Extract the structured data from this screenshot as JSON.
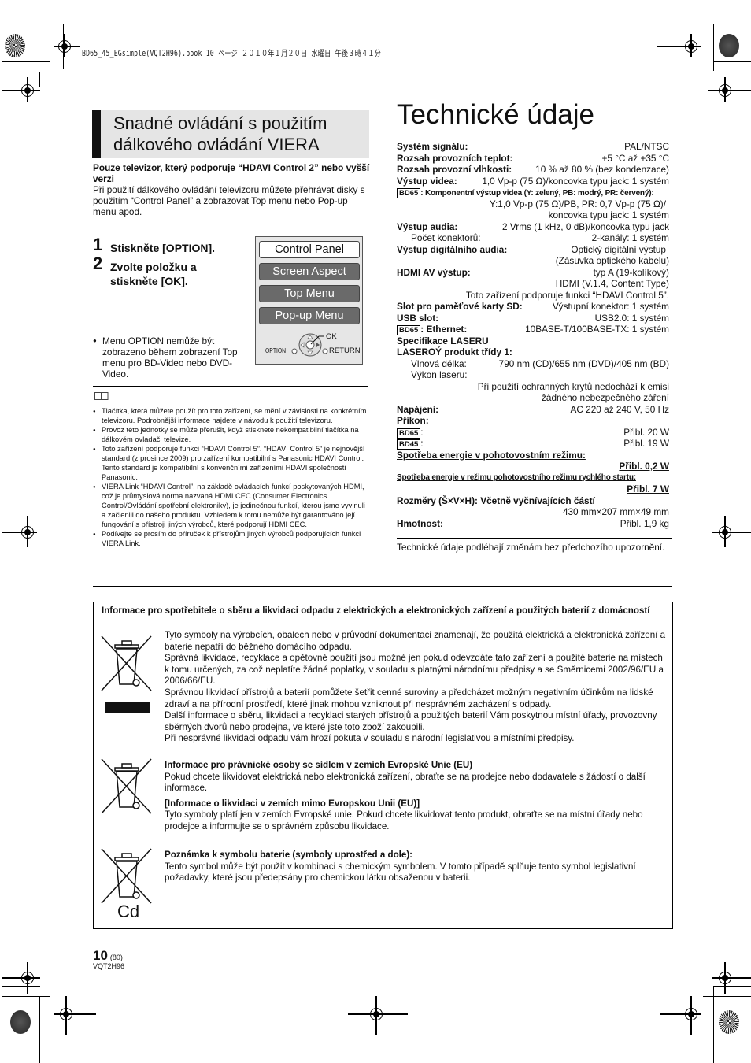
{
  "print_header": "BD65_45_EGsimple(VQT2H96).book  10 ページ  ２０１０年１月２０日  水曜日  午後３時４１分",
  "left": {
    "section_title_line1": "Snadné ovládání s použitím",
    "section_title_line2": "dálkového ovládání VIERA",
    "intro_bold": "Pouze televizor, který podporuje “HDAVI Control 2” nebo vyšší verzi",
    "intro_text": "Při použití dálkového ovládání televizoru můžete přehrávat disky s použitím “Control Panel” a zobrazovat Top menu nebo Pop-up menu apod.",
    "steps": [
      {
        "num": "1",
        "label": "Stiskněte [OPTION]."
      },
      {
        "num": "2",
        "label": "Zvolte položku a stiskněte [OK]."
      }
    ],
    "option_note": "Menu OPTION nemůže být zobrazeno během zobrazení Top menu pro BD-Video nebo DVD-Video.",
    "menu": {
      "items": [
        "Control Panel",
        "Screen Aspect",
        "Top Menu",
        "Pop-up Menu"
      ],
      "selected_index": 0,
      "ok_label": "OK",
      "option_label": "OPTION",
      "return_label": "RETURN"
    },
    "notes": [
      "Tlačítka, která můžete použít pro toto zařízení, se mění v závislosti na konkrétním televizoru. Podrobnější informace najdete v návodu k použití televizoru.",
      "Provoz této jednotky se může přerušit, když stisknete nekompatibilní tlačítka na dálkovém ovladači televize.",
      "Toto zařízení podporuje funkci “HDAVI Control 5”. “HDAVI Control 5” je nejnovější standard (z prosince 2009) pro zařízení kompatibilní s Panasonic HDAVI Control. Tento standard je kompatibilní s konvenčními zařízeními HDAVI společnosti Panasonic.",
      "VIERA Link “HDAVI Control”, na základě ovládacích funkcí poskytovaných HDMI, což je průmyslová norma nazvaná HDMI CEC (Consumer Electronics Control/Ovládání spotřební elektroniky), je jedinečnou funkcí, kterou jsme vyvinuli a začlenili do našeho produktu. Vzhledem k tomu nemůže být garantováno její fungování s přístroji jiných výrobců, které podporují HDMI CEC.",
      "Podívejte se prosím do příruček k přístrojům jiných výrobců podporujících funkci VIERA Link."
    ]
  },
  "right": {
    "title": "Technické údaje",
    "specs": {
      "signal_label": "Systém signálu:",
      "signal_value": "PAL/NTSC",
      "temp_label": "Rozsah provozních teplot:",
      "temp_value": "+5 °C až +35 °C",
      "humidity_label": "Rozsah provozní vlhkosti:",
      "humidity_value": "10 % až 80 % (bez kondenzace)",
      "video_label": "Výstup videa:",
      "video_value": "1,0 Vp-p (75 Ω)/koncovka typu jack: 1 systém",
      "bd65_badge": "BD65",
      "bd45_badge": "BD45",
      "component_label": ": Komponentní výstup videa (Y: zelený, PB: modrý, PR: červený):",
      "component_value1": "Y:1,0 Vp-p (75 Ω)/PB, PR: 0,7 Vp-p (75 Ω)/",
      "component_value2": "koncovka typu jack: 1 systém",
      "audio_label": "Výstup audia:",
      "audio_value": "2 Vrms (1 kHz, 0 dB)/koncovka typu jack",
      "connectors_label": "Počet konektorů:",
      "connectors_value": "2-kanály: 1 systém",
      "digital_audio_label": "Výstup digitálního audia:",
      "digital_audio_value1": "Optický digitální výstup",
      "digital_audio_value2": "(Zásuvka optického kabelu)",
      "hdmi_label": "HDMI AV výstup:",
      "hdmi_value1": "typ A (19-kolíkový)",
      "hdmi_value2": "HDMI (V.1.4, Content Type)",
      "hdmi_value3": "Toto zařízení podporuje funkci “HDAVI Control 5”.",
      "sd_label": "Slot pro paměťové karty SD:",
      "sd_value": "Výstupní konektor: 1 systém",
      "usb_label": "USB slot:",
      "usb_value": "USB2.0: 1 systém",
      "ethernet_label": ": Ethernet:",
      "ethernet_value": "10BASE-T/100BASE-TX: 1 systém",
      "laser_spec": "Specifikace LASERU",
      "laser_class": "LASEROÝ produkt třídy 1:",
      "wavelength_label": "Vlnová délka:",
      "wavelength_value": "790 nm (CD)/655 nm (DVD)/405 nm (BD)",
      "laser_power_label": "Výkon laseru:",
      "laser_power_value1": "Při použití ochranných krytů nedochází k emisi",
      "laser_power_value2": "žádného nebezpečného záření",
      "power_label": "Napájení:",
      "power_value": "AC 220 až 240 V, 50 Hz",
      "consumption_label": "Příkon:",
      "bd65_power": "Přibl. 20 W",
      "bd45_power": "Přibl. 19 W",
      "standby_label": "Spotřeba energie v pohotovostním režimu:",
      "standby_value": "Přibl. 0,2 W",
      "quickstart_label": "Spotřeba energie v režimu pohotovostního režimu rychlého startu:",
      "quickstart_value": "Přibl. 7 W",
      "dimensions_label": "Rozměry (Š×V×H): Včetně vyčnívajících částí",
      "dimensions_value": "430 mm×207 mm×49 mm",
      "weight_label": "Hmotnost:",
      "weight_value": "Přibl. 1,9 kg"
    },
    "note": "Technické údaje podléhají změnám bez předchozího upozornění."
  },
  "weee": {
    "title": "Informace pro spotřebitele o sběru a likvidaci odpadu z elektrických a elektronických zařízení a použitých baterií z domácností",
    "p1": "Tyto symboly na výrobcích, obalech nebo v průvodní dokumentaci znamenají, že použitá elektrická a elektronická zařízení a baterie nepatří do běžného domácího odpadu.",
    "p2": "Správná likvidace, recyklace a opětovné použití jsou možné jen pokud odevzdáte tato zařízení a použité baterie na místech k tomu určených, za což neplatíte žádné poplatky, v souladu s platnými národnímu předpisy a se Směrnicemi 2002/96/EU a 2006/66/EU.",
    "p3": "Správnou likvidací přístrojů a baterií pomůžete šetřit cenné suroviny a předcházet možným negativním účinkům na lidské zdraví a na přírodní prostředí, které jinak mohou vzniknout při nesprávném zacházení s odpady.",
    "p4": "Další informace o sběru, likvidaci a recyklaci starých přístrojů a použitých baterií Vám poskytnou místní úřady, provozovny sběrných dvorů nebo prodejna, ve které jste toto zboží zakoupili.",
    "p5": "Při nesprávné likvidaci odpadu vám hrozí pokuta v souladu s národní legislativou a místními předpisy.",
    "eu_title": "Informace pro právnické osoby se sídlem v zemích Evropské Unie (EU)",
    "eu_text": "Pokud chcete likvidovat elektrická nebo elektronická zařízení, obraťte se na prodejce nebo dodavatele s žádostí o další informace.",
    "non_eu_title": "[Informace o likvidaci v zemích mimo Evropskou Unii (EU)]",
    "non_eu_text": "Tyto symboly platí jen v zemích Evropské unie. Pokud chcete likvidovat tento produkt, obraťte se na místní úřady nebo prodejce a informujte se o správném způsobu likvidace.",
    "battery_title": "Poznámka k symbolu baterie (symboly uprostřed a dole):",
    "battery_text": "Tento symbol může být použit v kombinaci s chemickým symbolem. V tomto případě splňuje tento symbol legislativní požadavky, které jsou předepsány pro chemickou látku obsaženou v baterii.",
    "chem_symbol": "Cd"
  },
  "footer": {
    "page_number": "10",
    "page_total": "(80)",
    "doc_code": "VQT2H96"
  }
}
